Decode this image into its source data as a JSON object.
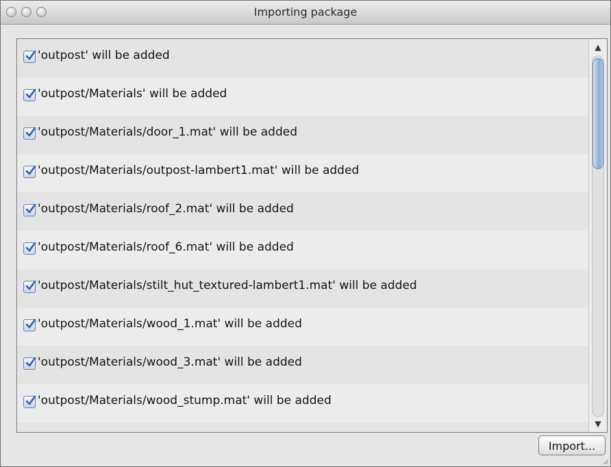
{
  "window": {
    "title": "Importing package"
  },
  "items": [
    {
      "label": "'outpost' will be added",
      "checked": true
    },
    {
      "label": "'outpost/Materials' will be added",
      "checked": true
    },
    {
      "label": "'outpost/Materials/door_1.mat' will be added",
      "checked": true
    },
    {
      "label": "'outpost/Materials/outpost-lambert1.mat' will be added",
      "checked": true
    },
    {
      "label": "'outpost/Materials/roof_2.mat' will be added",
      "checked": true
    },
    {
      "label": "'outpost/Materials/roof_6.mat' will be added",
      "checked": true
    },
    {
      "label": "'outpost/Materials/stilt_hut_textured-lambert1.mat' will be added",
      "checked": true
    },
    {
      "label": "'outpost/Materials/wood_1.mat' will be added",
      "checked": true
    },
    {
      "label": "'outpost/Materials/wood_3.mat' will be added",
      "checked": true
    },
    {
      "label": "'outpost/Materials/wood_stump.mat' will be added",
      "checked": true
    },
    {
      "label": "",
      "checked": true
    }
  ],
  "import_button": {
    "label": "Import..."
  },
  "scroll": {
    "up_arrow": "▲",
    "down_arrow": "▼"
  },
  "colors": {
    "checkbox_accent": "#3b5fa0",
    "thumb": "#8ca8cf",
    "window_bg": "#e6e6e6"
  }
}
